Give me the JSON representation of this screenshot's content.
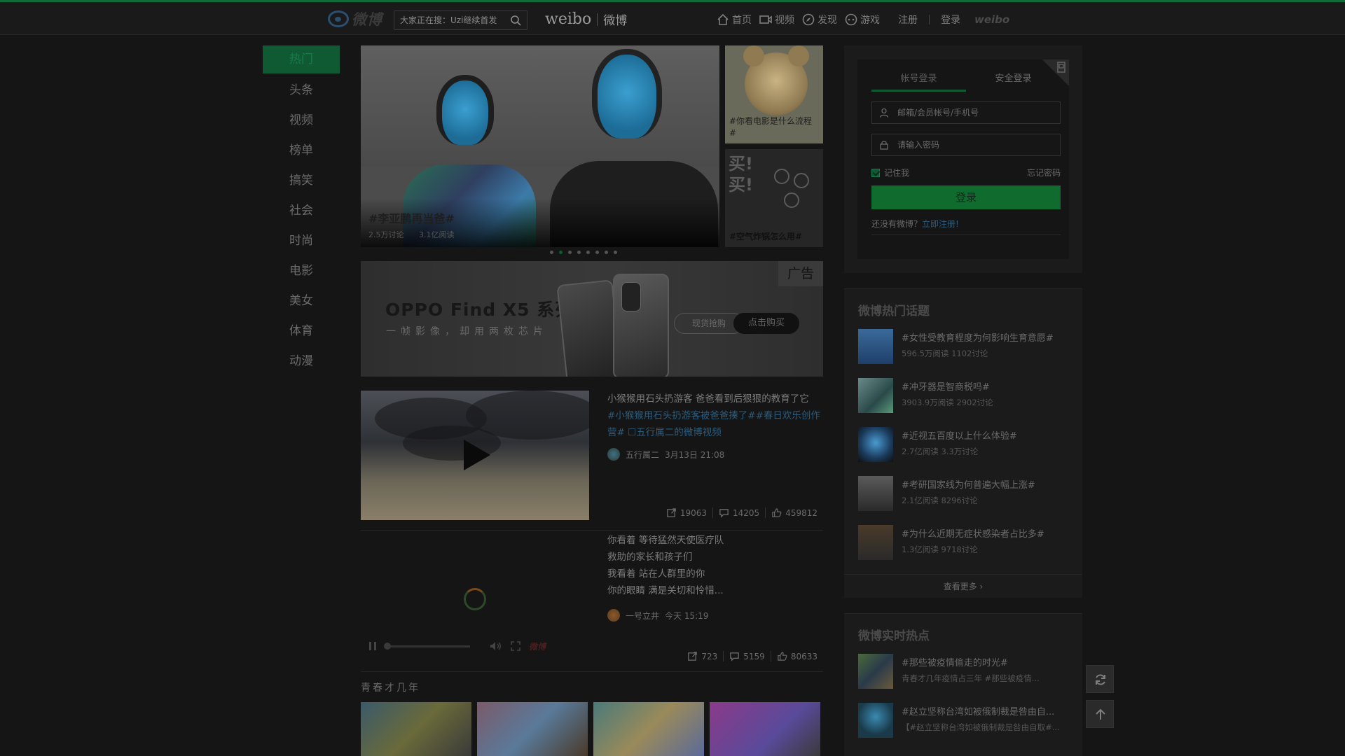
{
  "header": {
    "logo_text": "微博",
    "search_placeholder": "大家正在搜：Uzi继续首发",
    "brand_latin": "weibo",
    "brand_cn": "微博",
    "nav": [
      {
        "label": "首页",
        "icon": "home-icon"
      },
      {
        "label": "视频",
        "icon": "video-icon"
      },
      {
        "label": "发现",
        "icon": "compass-icon"
      },
      {
        "label": "游戏",
        "icon": "gamepad-icon"
      }
    ],
    "register": "注册",
    "login": "登录",
    "watermark": "weibo"
  },
  "leftnav": {
    "items": [
      "热门",
      "头条",
      "视频",
      "榜单",
      "搞笑",
      "社会",
      "时尚",
      "电影",
      "美女",
      "体育",
      "动漫"
    ],
    "active_index": 0
  },
  "carousel": {
    "main": {
      "title": "#李亚鹏再当爸#",
      "comments": "2.5万讨论",
      "reads": "3.1亿阅读"
    },
    "side": [
      {
        "caption": "#你看电影是什么流程#"
      },
      {
        "caption": "#空气炸锅怎么用#"
      }
    ],
    "dots": 8,
    "active_dot": 1
  },
  "ad": {
    "title": "OPPO Find X5 系列",
    "subtitle": "一帧影像，却用两枚芯片",
    "button1": "现货抢购",
    "button2": "点击购买",
    "tag": "广告"
  },
  "feed": [
    {
      "text": "小猴猴用石头扔游客 爸爸看到后狠狠的教育了它",
      "tags": "#小猴猴用石头扔游客被爸爸揍了##春日欢乐创作营# ☐五行属二的微博视频",
      "author": "五行属二",
      "time": "3月13日 21:08",
      "reposts": "19063",
      "comments": "14205",
      "likes": "459812"
    },
    {
      "lines": [
        "你看着 等待猛然天使医疗队",
        "救助的家长和孩子们",
        "我看着 站在人群里的你",
        "你的眼睛 满是关切和怜惜..."
      ],
      "author": "一号立井",
      "time": "今天 15:19",
      "reposts": "723",
      "comments": "5159",
      "likes": "80633",
      "player_brand": "微博"
    }
  ],
  "section": {
    "title": "青春才几年"
  },
  "login": {
    "tab_account": "帐号登录",
    "tab_secure": "安全登录",
    "user_placeholder": "邮箱/会员帐号/手机号",
    "pass_placeholder": "请输入密码",
    "remember": "记住我",
    "forgot": "忘记密码",
    "submit": "登录",
    "no_account": "还没有微博？",
    "register_link": "立即注册!"
  },
  "hot_topics": {
    "title": "微博热门话题",
    "items": [
      {
        "title": "#女性受教育程度为何影响生育意愿#",
        "stats": "596.5万阅读 1102讨论"
      },
      {
        "title": "#冲牙器是智商税吗#",
        "stats": "3903.9万阅读 2902讨论"
      },
      {
        "title": "#近视五百度以上什么体验#",
        "stats": "2.7亿阅读 3.3万讨论"
      },
      {
        "title": "#考研国家线为何普遍大幅上涨#",
        "stats": "2.1亿阅读 8296讨论"
      },
      {
        "title": "#为什么近期无症状感染者占比多#",
        "stats": "1.3亿阅读 9718讨论"
      }
    ],
    "more": "查看更多 ›"
  },
  "realtime": {
    "title": "微博实时热点",
    "items": [
      {
        "title": "#那些被疫情偷走的时光#",
        "stats": "青春才几年疫情占三年 #那些被疫情..."
      },
      {
        "title": "#赵立坚称台湾如被俄制裁是咎由自...",
        "stats": "【#赵立坚称台湾如被俄制裁是咎由自取#..."
      }
    ]
  },
  "colors": {
    "accent": "#0f5a33",
    "link": "#2b5d7f",
    "background": "#151515"
  }
}
